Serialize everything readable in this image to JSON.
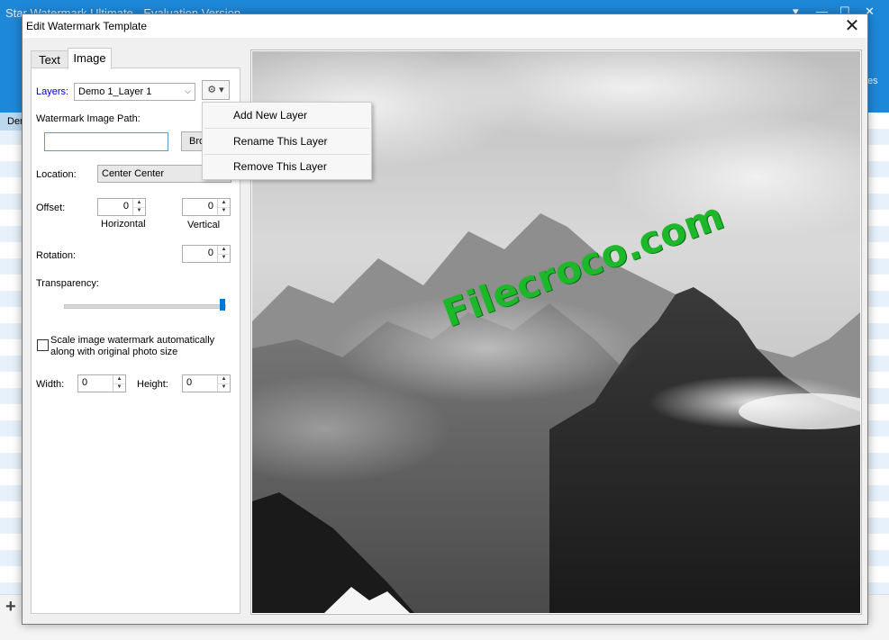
{
  "background_app": {
    "title": "Star Watermark Ultimate - Evaluation Version",
    "window_controls": [
      "▾",
      "—",
      "☐",
      "✕"
    ],
    "right_toolbar_text": "es",
    "list_header": "Der",
    "add_button": "+"
  },
  "dialog": {
    "title": "Edit Watermark Template",
    "close_glyph": "✕"
  },
  "tabs": [
    {
      "label": "Text",
      "active": false
    },
    {
      "label": "Image",
      "active": true
    }
  ],
  "form": {
    "layers_label": "Layers:",
    "layers_value": "Demo 1_Layer 1",
    "gear_glyph": "⚙ ▾",
    "image_path_label": "Watermark Image Path:",
    "image_path_value": "",
    "browse_label": "Browse...",
    "location_label": "Location:",
    "location_value": "Center Center",
    "offset_label": "Offset:",
    "offset_horizontal_value": "0",
    "offset_horizontal_label": "Horizontal",
    "offset_vertical_value": "0",
    "offset_vertical_label": "Vertical",
    "rotation_label": "Rotation:",
    "rotation_value": "0",
    "transparency_label": "Transparency:",
    "transparency_level": 1.0,
    "scale_line1": "Scale image watermark automatically",
    "scale_line2": "along with original photo size",
    "scale_checked": false,
    "width_label": "Width:",
    "width_value": "0",
    "height_label": "Height:",
    "height_value": "0"
  },
  "gear_menu": {
    "items": [
      "Add New Layer",
      "Rename This Layer",
      "Remove This Layer"
    ]
  },
  "preview": {
    "watermark_text": "Filecroco.com",
    "watermark_color": "#1db82a"
  },
  "colors": {
    "accent_blue": "#1e88d8",
    "label_blue": "#0000cc",
    "slider_blue": "#0078d7"
  }
}
